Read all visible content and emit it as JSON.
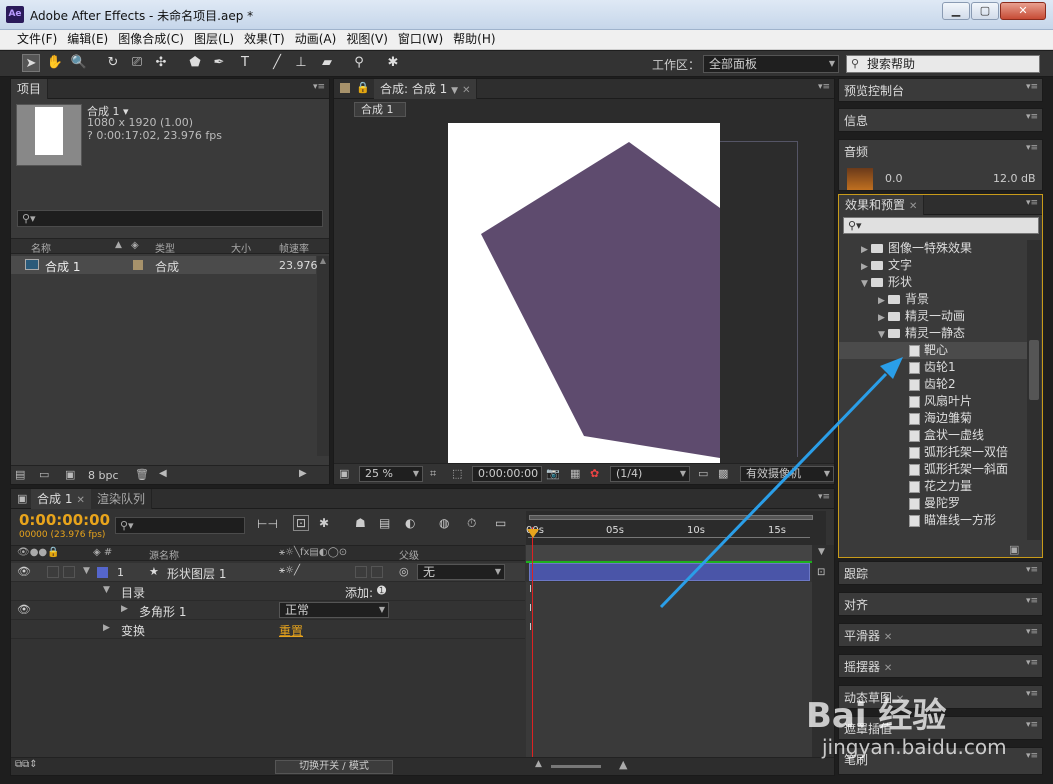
{
  "window": {
    "app_icon": "Ae",
    "title": "Adobe After Effects - 未命名项目.aep *",
    "minimize": "▁",
    "maximize": "▢",
    "close": "✕"
  },
  "menu": [
    "文件(F)",
    "编辑(E)",
    "图像合成(C)",
    "图层(L)",
    "效果(T)",
    "动画(A)",
    "视图(V)",
    "窗口(W)",
    "帮助(H)"
  ],
  "toolbar": {
    "workspace_label": "工作区：",
    "workspace_value": "全部面板",
    "search_help": "搜索帮助"
  },
  "project": {
    "tab": "项目",
    "comp_name": "合成 1 ▾",
    "comp_dims": "1080 x 1920 (1.00)",
    "comp_duration": "? 0:00:17:02, 23.976 fps",
    "columns": [
      "名称",
      "类型",
      "大小",
      "帧速率"
    ],
    "row": {
      "name": "合成 1",
      "type": "合成",
      "fps": "23.976"
    },
    "bpc": "8 bpc"
  },
  "composition": {
    "tab": "合成: 合成 1",
    "subtab": "合成 1",
    "zoom": "25 %",
    "timecode": "0:00:00:00",
    "resolution": "(1/4)",
    "camera": "有效摄像机"
  },
  "right_panels": {
    "preview": "预览控制台",
    "info": "信息",
    "audio": "音频",
    "audio_left": "0.0",
    "audio_right": "12.0 dB",
    "effects": "效果和预置",
    "tracker": "跟踪",
    "align": "对齐",
    "smoother": "平滑器",
    "wiggler": "摇摆器",
    "motion_sketch": "动态草图",
    "mask_interp": "遮罩插值",
    "brush": "笔刷"
  },
  "effects_tree": [
    {
      "label": "图像一特殊效果",
      "level": 1,
      "kind": "folder",
      "open": false
    },
    {
      "label": "文字",
      "level": 1,
      "kind": "folder",
      "open": false
    },
    {
      "label": "形状",
      "level": 1,
      "kind": "folder",
      "open": true
    },
    {
      "label": "背景",
      "level": 2,
      "kind": "folder",
      "open": false
    },
    {
      "label": "精灵一动画",
      "level": 2,
      "kind": "folder",
      "open": false
    },
    {
      "label": "精灵一静态",
      "level": 2,
      "kind": "folder",
      "open": true
    },
    {
      "label": "靶心",
      "level": 3,
      "kind": "preset",
      "selected": true
    },
    {
      "label": "齿轮1",
      "level": 3,
      "kind": "preset"
    },
    {
      "label": "齿轮2",
      "level": 3,
      "kind": "preset"
    },
    {
      "label": "风扇叶片",
      "level": 3,
      "kind": "preset"
    },
    {
      "label": "海边雏菊",
      "level": 3,
      "kind": "preset"
    },
    {
      "label": "盒状一虚线",
      "level": 3,
      "kind": "preset"
    },
    {
      "label": "弧形托架一双倍",
      "level": 3,
      "kind": "preset"
    },
    {
      "label": "弧形托架一斜面",
      "level": 3,
      "kind": "preset"
    },
    {
      "label": "花之力量",
      "level": 3,
      "kind": "preset"
    },
    {
      "label": "曼陀罗",
      "level": 3,
      "kind": "preset"
    },
    {
      "label": "瞄准线一方形",
      "level": 3,
      "kind": "preset"
    }
  ],
  "timeline": {
    "tab1": "合成 1",
    "tab2": "渲染队列",
    "timecode": "0:00:00:00",
    "frame_info": "00000 (23.976 fps)",
    "col_source": "源名称",
    "col_parent": "父级",
    "layer_num": "1",
    "layer_name": "形状图层 1",
    "parent_value": "无",
    "contents": "目录",
    "add": "添加:",
    "polygon": "多角形 1",
    "blend_mode": "正常",
    "transform": "变换",
    "reset": "重置",
    "ruler": [
      "00s",
      "05s",
      "10s",
      "15s"
    ],
    "switch_mode": "切换开关 / 模式"
  },
  "watermark": {
    "text": "Bai 经验",
    "url": "jingyan.baidu.com"
  },
  "colors": {
    "accent": "#e8a41c",
    "shape": "#5e4b6e",
    "layer_bar": "#4a55a8",
    "arrow": "#2a9ee8"
  }
}
